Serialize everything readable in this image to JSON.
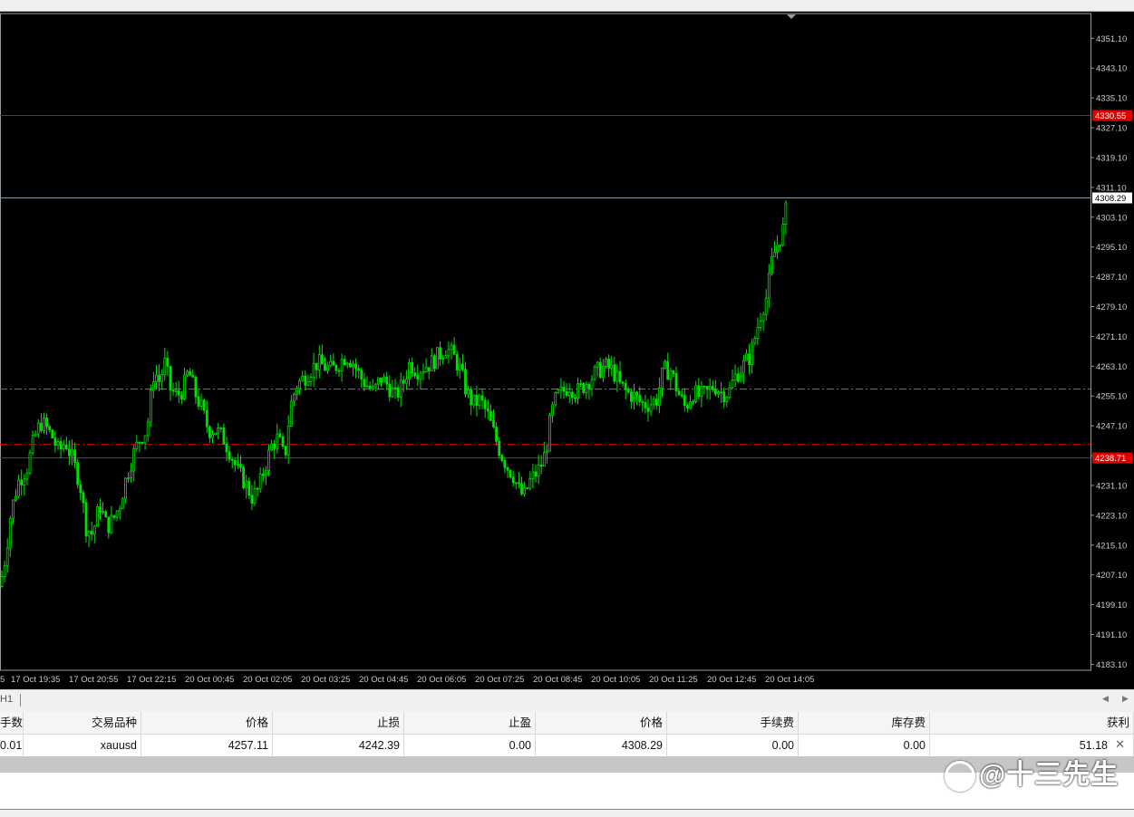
{
  "chart_data": {
    "type": "candlestick",
    "symbol": "xauusd",
    "price_axis_labels": [
      "4351.10",
      "4343.10",
      "4335.10",
      "4327.10",
      "4319.10",
      "4311.10",
      "4303.10",
      "4295.10",
      "4287.10",
      "4279.10",
      "4271.10",
      "4263.10",
      "4255.10",
      "4247.10",
      "4239.10",
      "4231.10",
      "4223.10",
      "4215.10",
      "4207.10",
      "4199.10",
      "4191.10",
      "4183.10"
    ],
    "ylim": [
      4181.5,
      4357.5
    ],
    "time_axis_labels": [
      "5",
      "17 Oct 19:35",
      "17 Oct 20:55",
      "17 Oct 22:15",
      "20 Oct 00:45",
      "20 Oct 02:05",
      "20 Oct 03:25",
      "20 Oct 04:45",
      "20 Oct 06:05",
      "20 Oct 07:25",
      "20 Oct 08:45",
      "20 Oct 10:05",
      "20 Oct 11:25",
      "20 Oct 12:45",
      "20 Oct 14:05"
    ],
    "lines": [
      {
        "price": 4330.55,
        "label": "4330.55",
        "style": "solid",
        "color": "#e00000",
        "tag": "take-profit"
      },
      {
        "price": 4308.29,
        "label": "4308.29",
        "style": "solid",
        "color": "#8a9aa8",
        "tag": "bid"
      },
      {
        "price": 4257.11,
        "label": "",
        "style": "dashdot",
        "color": "#2e9e2e",
        "tag": "entry"
      },
      {
        "price": 4242.39,
        "label": "",
        "style": "dashdot",
        "color": "#c00000",
        "tag": "stop-loss"
      },
      {
        "price": 4238.71,
        "label": "4238.71",
        "style": "solid",
        "color": "#e00000",
        "tag": "level"
      }
    ],
    "close_path": [
      [
        0,
        4204
      ],
      [
        6,
        4212
      ],
      [
        12,
        4224
      ],
      [
        20,
        4232
      ],
      [
        30,
        4236
      ],
      [
        38,
        4244
      ],
      [
        45,
        4248
      ],
      [
        50,
        4247
      ],
      [
        58,
        4244
      ],
      [
        65,
        4240
      ],
      [
        72,
        4243
      ],
      [
        80,
        4238
      ],
      [
        88,
        4232
      ],
      [
        95,
        4220
      ],
      [
        102,
        4218
      ],
      [
        110,
        4226
      ],
      [
        118,
        4220
      ],
      [
        125,
        4222
      ],
      [
        132,
        4226
      ],
      [
        140,
        4234
      ],
      [
        148,
        4240
      ],
      [
        155,
        4244
      ],
      [
        162,
        4246
      ],
      [
        170,
        4262
      ],
      [
        176,
        4259
      ],
      [
        182,
        4264
      ],
      [
        188,
        4257
      ],
      [
        195,
        4255
      ],
      [
        202,
        4257
      ],
      [
        208,
        4262
      ],
      [
        215,
        4256
      ],
      [
        222,
        4252
      ],
      [
        230,
        4246
      ],
      [
        238,
        4246
      ],
      [
        246,
        4244
      ],
      [
        254,
        4240
      ],
      [
        262,
        4235
      ],
      [
        270,
        4232
      ],
      [
        278,
        4228
      ],
      [
        285,
        4230
      ],
      [
        292,
        4236
      ],
      [
        300,
        4242
      ],
      [
        307,
        4244
      ],
      [
        314,
        4238
      ],
      [
        320,
        4252
      ],
      [
        327,
        4258
      ],
      [
        335,
        4260
      ],
      [
        342,
        4262
      ],
      [
        350,
        4264
      ],
      [
        358,
        4263
      ],
      [
        366,
        4262
      ],
      [
        374,
        4264
      ],
      [
        382,
        4266
      ],
      [
        390,
        4264
      ],
      [
        398,
        4260
      ],
      [
        405,
        4258
      ],
      [
        412,
        4256
      ],
      [
        420,
        4260
      ],
      [
        428,
        4258
      ],
      [
        436,
        4255
      ],
      [
        444,
        4258
      ],
      [
        452,
        4264
      ],
      [
        460,
        4262
      ],
      [
        468,
        4263
      ],
      [
        476,
        4264
      ],
      [
        484,
        4266
      ],
      [
        492,
        4268
      ],
      [
        500,
        4266
      ],
      [
        508,
        4262
      ],
      [
        515,
        4256
      ],
      [
        522,
        4253
      ],
      [
        530,
        4254
      ],
      [
        538,
        4250
      ],
      [
        545,
        4245
      ],
      [
        552,
        4240
      ],
      [
        560,
        4236
      ],
      [
        566,
        4234
      ],
      [
        572,
        4230
      ],
      [
        578,
        4228
      ],
      [
        584,
        4232
      ],
      [
        590,
        4234
      ],
      [
        596,
        4236
      ],
      [
        602,
        4240
      ],
      [
        608,
        4250
      ],
      [
        614,
        4255
      ],
      [
        620,
        4256
      ],
      [
        628,
        4258
      ],
      [
        636,
        4256
      ],
      [
        644,
        4258
      ],
      [
        652,
        4260
      ],
      [
        660,
        4262
      ],
      [
        668,
        4263
      ],
      [
        676,
        4262
      ],
      [
        684,
        4258
      ],
      [
        692,
        4256
      ],
      [
        700,
        4255
      ],
      [
        708,
        4253
      ],
      [
        716,
        4253
      ],
      [
        724,
        4254
      ],
      [
        732,
        4262
      ],
      [
        740,
        4262
      ],
      [
        748,
        4256
      ],
      [
        756,
        4252
      ],
      [
        764,
        4256
      ],
      [
        772,
        4255
      ],
      [
        780,
        4256
      ],
      [
        788,
        4258
      ],
      [
        796,
        4256
      ],
      [
        804,
        4256
      ],
      [
        810,
        4260
      ],
      [
        816,
        4262
      ],
      [
        822,
        4264
      ],
      [
        828,
        4266
      ],
      [
        834,
        4272
      ],
      [
        840,
        4278
      ],
      [
        846,
        4282
      ],
      [
        852,
        4292
      ],
      [
        858,
        4296
      ],
      [
        864,
        4300
      ],
      [
        869,
        4308
      ]
    ],
    "candle_spacing": 3.1
  },
  "tab": {
    "label": "H1",
    "nav_left": "◀",
    "nav_right": "▶"
  },
  "positions_table": {
    "headers": [
      "手数",
      "交易品种",
      "价格",
      "止损",
      "止盈",
      "价格",
      "手续费",
      "库存费",
      "获利"
    ],
    "rows": [
      [
        "0.01",
        "xauusd",
        "4257.11",
        "4242.39",
        "0.00",
        "4308.29",
        "0.00",
        "0.00",
        "51.18"
      ]
    ],
    "close_glyph": "✕"
  },
  "watermark": {
    "text": "@十三先生"
  }
}
